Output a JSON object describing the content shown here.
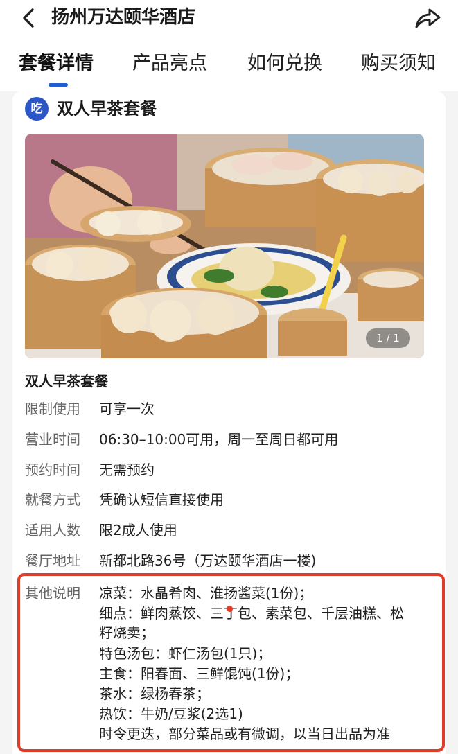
{
  "header": {
    "title": "扬州万达颐华酒店"
  },
  "tabs": [
    {
      "label": "套餐详情",
      "active": true
    },
    {
      "label": "产品亮点",
      "active": false
    },
    {
      "label": "如何兑换",
      "active": false
    },
    {
      "label": "购买须知",
      "active": false
    }
  ],
  "package": {
    "badge": "吃",
    "title": "双人早茶套餐",
    "photo_counter": "1 / 1",
    "subtitle": "双人早茶套餐"
  },
  "details": [
    {
      "label": "限制使用",
      "value": "可享一次"
    },
    {
      "label": "营业时间",
      "value": "06:30–10:00可用，周一至周日都可用"
    },
    {
      "label": "预约时间",
      "value": "无需预约"
    },
    {
      "label": "就餐方式",
      "value": "凭确认短信直接使用"
    },
    {
      "label": "适用人数",
      "value": "限2成人使用"
    },
    {
      "label": "餐厅地址",
      "value": "新都北路36号（万达颐华酒店一楼)"
    }
  ],
  "other": {
    "label": "其他说明",
    "lines": [
      "凉菜：水晶肴肉、淮扬酱菜(1份)；",
      "细点：鲜肉蒸饺、三丁包、素菜包、千层油糕、松",
      "籽烧卖；",
      "特色汤包：虾仁汤包(1只)；",
      "主食：阳春面、三鲜馄饨(1份)；",
      "茶水：绿杨春茶；",
      "热饮：牛奶/豆浆(2选1)",
      "时令更迭，部分菜品或有微调，以当日出品为准"
    ]
  },
  "colors": {
    "accent": "#1f5fd1",
    "badge": "#2a56c6",
    "highlight": "#e23b2a"
  },
  "icons": {
    "back": "back-arrow-icon",
    "share": "share-icon"
  }
}
